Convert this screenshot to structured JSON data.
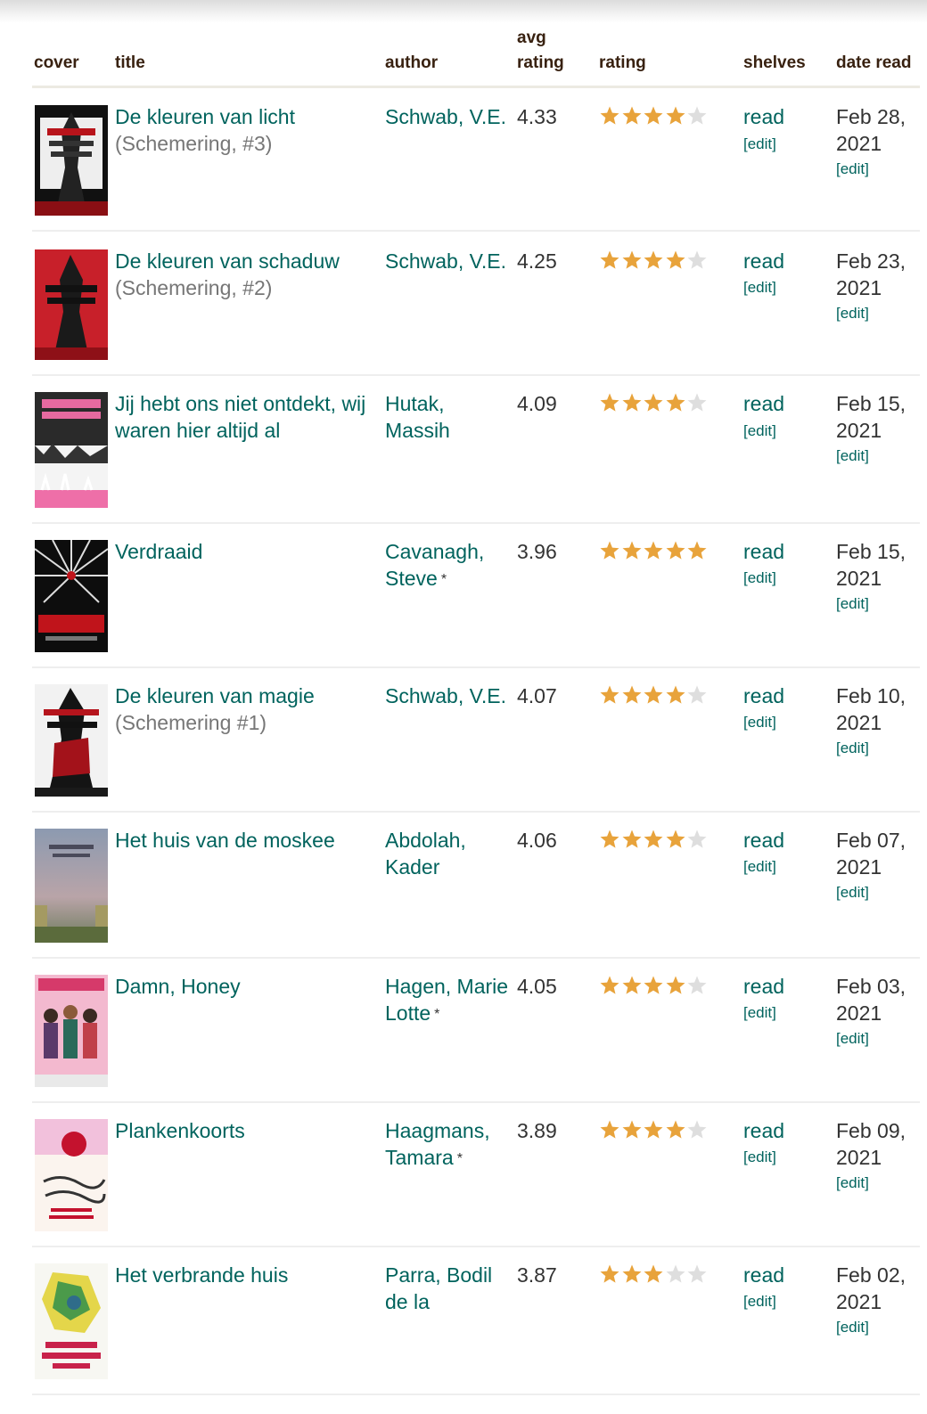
{
  "header": {
    "cover": "cover",
    "title": "title",
    "author": "author",
    "avg_line1": "avg",
    "avg_line2": "rating",
    "rating": "rating",
    "shelves": "shelves",
    "date_read": "date read"
  },
  "colors": {
    "link": "#00635d",
    "star_on": "#e8a33b",
    "star_off": "#dedede",
    "text": "#333333",
    "header": "#382110"
  },
  "books": [
    {
      "title": "De kleuren van licht",
      "series": "(Schemering, #3)",
      "author": "Schwab, V.E.",
      "author_mark": "",
      "avg": "4.33",
      "stars": 4,
      "shelf": "read",
      "shelf_edit": "[edit]",
      "date": "Feb 28, 2021",
      "date_edit": "[edit]",
      "cover_icon": "book-cover-icon"
    },
    {
      "title": "De kleuren van schaduw",
      "series": "(Schemering, #2)",
      "author": "Schwab, V.E.",
      "author_mark": "",
      "avg": "4.25",
      "stars": 4,
      "shelf": "read",
      "shelf_edit": "[edit]",
      "date": "Feb 23, 2021",
      "date_edit": "[edit]",
      "cover_icon": "book-cover-icon"
    },
    {
      "title": "Jij hebt ons niet ontdekt, wij waren hier altijd al",
      "series": "",
      "author": "Hutak, Massih",
      "author_mark": "",
      "avg": "4.09",
      "stars": 4,
      "shelf": "read",
      "shelf_edit": "[edit]",
      "date": "Feb 15, 2021",
      "date_edit": "[edit]",
      "cover_icon": "book-cover-icon"
    },
    {
      "title": "Verdraaid",
      "series": "",
      "author": "Cavanagh, Steve",
      "author_mark": "*",
      "avg": "3.96",
      "stars": 5,
      "shelf": "read",
      "shelf_edit": "[edit]",
      "date": "Feb 15, 2021",
      "date_edit": "[edit]",
      "cover_icon": "book-cover-icon"
    },
    {
      "title": "De kleuren van magie",
      "series": "(Schemering #1)",
      "author": "Schwab, V.E.",
      "author_mark": "",
      "avg": "4.07",
      "stars": 4,
      "shelf": "read",
      "shelf_edit": "[edit]",
      "date": "Feb 10, 2021",
      "date_edit": "[edit]",
      "cover_icon": "book-cover-icon"
    },
    {
      "title": "Het huis van de moskee",
      "series": "",
      "author": "Abdolah, Kader",
      "author_mark": "",
      "avg": "4.06",
      "stars": 4,
      "shelf": "read",
      "shelf_edit": "[edit]",
      "date": "Feb 07, 2021",
      "date_edit": "[edit]",
      "cover_icon": "book-cover-icon"
    },
    {
      "title": "Damn, Honey",
      "series": "",
      "author": "Hagen, Marie Lotte",
      "author_mark": "*",
      "avg": "4.05",
      "stars": 4,
      "shelf": "read",
      "shelf_edit": "[edit]",
      "date": "Feb 03, 2021",
      "date_edit": "[edit]",
      "cover_icon": "book-cover-icon"
    },
    {
      "title": "Plankenkoorts",
      "series": "",
      "author": "Haagmans, Tamara",
      "author_mark": "*",
      "avg": "3.89",
      "stars": 4,
      "shelf": "read",
      "shelf_edit": "[edit]",
      "date": "Feb 09, 2021",
      "date_edit": "[edit]",
      "cover_icon": "book-cover-icon"
    },
    {
      "title": "Het verbrande huis",
      "series": "",
      "author": "Parra, Bodil de la",
      "author_mark": "",
      "avg": "3.87",
      "stars": 3,
      "shelf": "read",
      "shelf_edit": "[edit]",
      "date": "Feb 02, 2021",
      "date_edit": "[edit]",
      "cover_icon": "book-cover-icon"
    }
  ]
}
